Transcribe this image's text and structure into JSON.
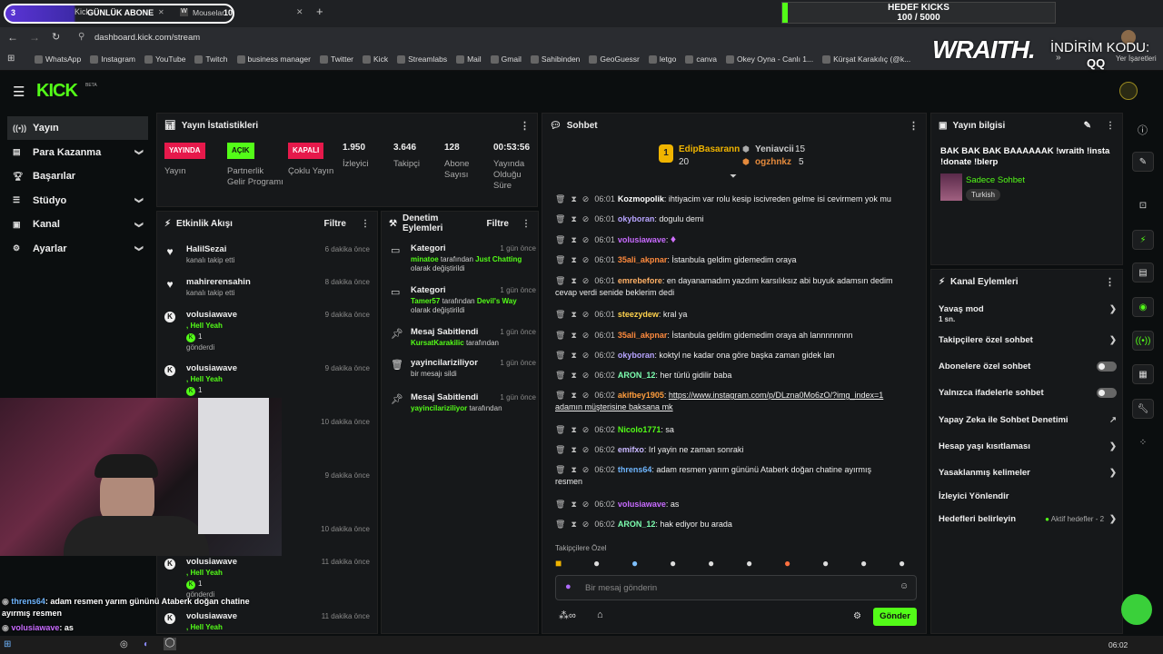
{
  "browser": {
    "tab1_counter": "3",
    "tab1_label": "Kick",
    "tab1_overlay": "GÜNLÜK ABONE",
    "tab2_label": "Mouselar",
    "tab2_counter": "10",
    "url": "dashboard.kick.com/stream",
    "bookmarks": [
      "WhatsApp",
      "Instagram",
      "YouTube",
      "Twitch",
      "business manager",
      "Twitter",
      "Kick",
      "Streamlabs",
      "Mail",
      "Gmail",
      "Sahibinden",
      "GeoGuessr",
      "letgo",
      "canva",
      "Okey Oyna - Canlı 1...",
      "Kürşat Karakılıç (@k..."
    ],
    "bookmarks_more": "»",
    "bookmark_right": "Yer İşaretleri"
  },
  "overlay": {
    "goal_title": "HEDEF KICKS",
    "goal_value": "100 / 5000",
    "goal_progress": 0.02,
    "sponsor": "WRAITH.",
    "discount": "İNDİRİM KODU:",
    "code": "QQ"
  },
  "app": {
    "logo": "KICK",
    "beta": "BETA"
  },
  "nav": [
    {
      "label": "Yayın",
      "icon": "broadcast-icon"
    },
    {
      "label": "Para Kazanma",
      "icon": "money-icon"
    },
    {
      "label": "Başarılar",
      "icon": "trophy-icon"
    },
    {
      "label": "Stüdyo",
      "icon": "studio-icon"
    },
    {
      "label": "Kanal",
      "icon": "channel-icon"
    },
    {
      "label": "Ayarlar",
      "icon": "settings-icon"
    }
  ],
  "stats": {
    "title": "Yayın İstatistikleri",
    "items": [
      {
        "badge": "YAYINDA",
        "badge_color": "#e6194b",
        "label": "Yayın"
      },
      {
        "badge": "AÇIK",
        "badge_color": "#53fc18",
        "label": "Partnerlik Gelir Programı"
      },
      {
        "badge": "KAPALI",
        "badge_color": "#e6194b",
        "label": "Çoklu Yayın"
      },
      {
        "value": "1.950",
        "label": "İzleyici"
      },
      {
        "value": "3.646",
        "label": "Takipçi"
      },
      {
        "value": "128",
        "label": "Abone Sayısı"
      },
      {
        "value": "00:53:56",
        "label": "Yayında Olduğu Süre"
      }
    ]
  },
  "activity": {
    "title": "Etkinlik Akışı",
    "filter": "Filtre",
    "items": [
      {
        "name": "HalilSezai",
        "sub": "kanalı takip etti",
        "time": "6 dakika önce"
      },
      {
        "name": "mahirerensahin",
        "sub": "kanalı takip etti",
        "time": "8 dakika önce"
      },
      {
        "name": "volusiawave",
        "sub": ", Hell Yeah",
        "extra": "1",
        "sub2": "gönderdi",
        "time": "9 dakika önce"
      },
      {
        "name": "volusiawave",
        "sub": ", Hell Yeah",
        "extra": "1",
        "sub2": "gönderdi",
        "time": "9 dakika önce"
      },
      {
        "time": "10 dakika önce"
      },
      {
        "time": "9 dakika önce"
      },
      {
        "time": "10 dakika önce"
      },
      {
        "name": "volusiawave",
        "sub": ", Hell Yeah",
        "extra": "1",
        "sub2": "gönderdi",
        "time": "11 dakika önce"
      },
      {
        "name": "volusiawave",
        "sub": ", Hell Yeah",
        "time": "11 dakika önce"
      }
    ]
  },
  "moderation": {
    "title": "Denetim Eylemleri",
    "filter": "Filtre",
    "items": [
      {
        "title": "Kategori",
        "time": "1 gün önce",
        "user": "minatoe",
        "mid": "tarafından",
        "val": "Just Chatting",
        "end": "olarak değiştirildi"
      },
      {
        "title": "Kategori",
        "time": "1 gün önce",
        "user": "Tamer57",
        "mid": "tarafından",
        "val": "Devil's Way",
        "end": "olarak değiştirildi"
      },
      {
        "title": "Mesaj Sabitlendi",
        "time": "1 gün önce",
        "user": "KursatKarakilic",
        "mid": "tarafından"
      },
      {
        "title": "yayincilariziliyor",
        "time": "1 gün önce",
        "end": "bir mesajı sildi"
      },
      {
        "title": "Mesaj Sabitlendi",
        "time": "1 gün önce",
        "user": "yayincilariziliyor",
        "mid": "tarafından"
      }
    ]
  },
  "chat": {
    "title": "Sohbet",
    "top1_name": "EdipBasarann",
    "top1_val": "20",
    "top1_rank": "1",
    "top2_name": "Yeniavcii",
    "top2_val": "15",
    "top3_name": "ogzhnkz",
    "top3_val": "5",
    "messages": [
      {
        "ts": "06:01",
        "user": "Kozmopolik",
        "color": "#ffffff",
        "text": "ihtiyacim var rolu kesip iscivreden gelme isi cevirmem yok mu"
      },
      {
        "ts": "06:01",
        "user": "okyboran",
        "color": "#b7a4ff",
        "text": "dogulu demi"
      },
      {
        "ts": "06:01",
        "user": "volusiawave",
        "color": "#c86bff",
        "text": ""
      },
      {
        "ts": "06:01",
        "user": "35ali_akpnar",
        "color": "#ff8a3d",
        "text": "İstanbula geldim gidemedim oraya"
      },
      {
        "ts": "06:01",
        "user": "emrebefore",
        "color": "#ffb066",
        "text": "en dayanamadım yazdım karsılıksız abi buyuk adamsın dedim cevap verdi senide beklerim dedi"
      },
      {
        "ts": "06:01",
        "user": "steezydew",
        "color": "#ffd24d",
        "text": "kral ya"
      },
      {
        "ts": "06:01",
        "user": "35ali_akpnar",
        "color": "#ff8a3d",
        "text": "İstanbula geldim gidemedim oraya ah lannnnnnnn"
      },
      {
        "ts": "06:02",
        "user": "okyboran",
        "color": "#b7a4ff",
        "text": "koktyl ne kadar ona göre başka zaman gidek lan"
      },
      {
        "ts": "06:02",
        "user": "ARON_12",
        "color": "#7dffb0",
        "text": "her türlü gidilir baba"
      },
      {
        "ts": "06:02",
        "user": "akifbey1905",
        "color": "#ff9d3d",
        "text": "https://www.instagram.com/p/DLzna0Mo6zO/?img_index=1 adamın müşterisine baksana mk"
      },
      {
        "ts": "06:02",
        "user": "Nicolo1771",
        "color": "#53fc18",
        "text": "sa"
      },
      {
        "ts": "06:02",
        "user": "emifxo",
        "color": "#c9b8ff",
        "text": "Irl yayin ne zaman sonraki"
      },
      {
        "ts": "06:02",
        "user": "threns64",
        "color": "#6fb6ff",
        "text": "adam resmen yarım gününü Ataberk doğan chatine ayırmış resmen"
      },
      {
        "ts": "06:02",
        "user": "volusiawave",
        "color": "#c86bff",
        "text": "as"
      },
      {
        "ts": "06:02",
        "user": "ARON_12",
        "color": "#7dffb0",
        "text": "hak ediyor bu arada"
      }
    ],
    "followers_only": "Takipçilere Özel",
    "input_placeholder": "Bir mesaj gönderin",
    "send": "Gönder"
  },
  "info": {
    "title": "Yayın bilgisi",
    "stream_title": "BAK BAK BAK BAAAAAAK !wraith !insta !donate !blerp",
    "category": "Sadece Sohbet",
    "language": "Turkish"
  },
  "actions": {
    "title": "Kanal Eylemleri",
    "slow_mode": "Yavaş mod",
    "slow_val": "1 sn.",
    "followers": "Takipçilere özel sohbet",
    "subs": "Abonelere özel sohbet",
    "emotes": "Yalnızca ifadelerle sohbet",
    "ai": "Yapay Zeka ile Sohbet Denetimi",
    "age": "Hesap yaşı kısıtlaması",
    "banned": "Yasaklanmış kelimeler",
    "redirect": "İzleyici Yönlendir",
    "goals": "Hedefleri belirleyin",
    "goals_val": "Aktif hedefler - 2"
  },
  "webcam_chat": [
    {
      "user": "threns64",
      "text": ": adam resmen yarım gününü Ataberk doğan chatine ayırmış resmen"
    },
    {
      "user": "volusiawave",
      "text": ": as"
    },
    {
      "user": "ARON_12",
      "text": ": hak ediyor bu arada"
    }
  ],
  "taskbar_time": "06:02"
}
